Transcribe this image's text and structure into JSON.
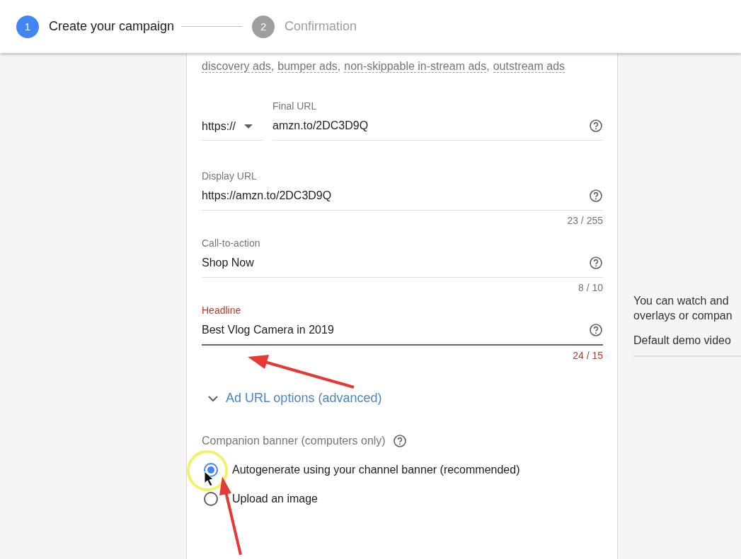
{
  "stepper": {
    "steps": [
      {
        "number": "1",
        "label": "Create your campaign",
        "selected": true
      },
      {
        "number": "2",
        "label": "Confirmation",
        "selected": false
      }
    ]
  },
  "ad_formats": [
    {
      "link": "discovery ads",
      "after": ","
    },
    {
      "link": "bumper ads",
      "after": ","
    },
    {
      "link": "non-skippable in-stream ads",
      "after": ","
    },
    {
      "link": "outstream ads"
    }
  ],
  "fields": [
    {
      "kind": "url",
      "label": "Final URL",
      "protocol": "https://",
      "value": "amzn.to/2DC3D9Q"
    },
    {
      "kind": "text",
      "label": "Display URL",
      "value": "https://amzn.to/2DC3D9Q",
      "counter": "23 / 255",
      "error": false
    },
    {
      "kind": "text",
      "label": "Call-to-action",
      "value": "Shop Now",
      "counter": "8 / 10",
      "error": false
    },
    {
      "kind": "text",
      "label": "Headline",
      "value": "Best Vlog Camera in 2019",
      "counter": "24 / 15",
      "error": true
    }
  ],
  "ad_url_options": {
    "label": "Ad URL options (advanced)",
    "expanded": false
  },
  "companion_banner": {
    "label": "Companion banner (computers only)",
    "options": [
      {
        "label": "Autogenerate using your channel banner (recommended)",
        "selected": true
      },
      {
        "label": "Upload an image",
        "selected": false
      }
    ]
  },
  "side_panel": {
    "lines": [
      "You can watch and",
      "overlays or compan"
    ],
    "video": "Default demo video"
  }
}
